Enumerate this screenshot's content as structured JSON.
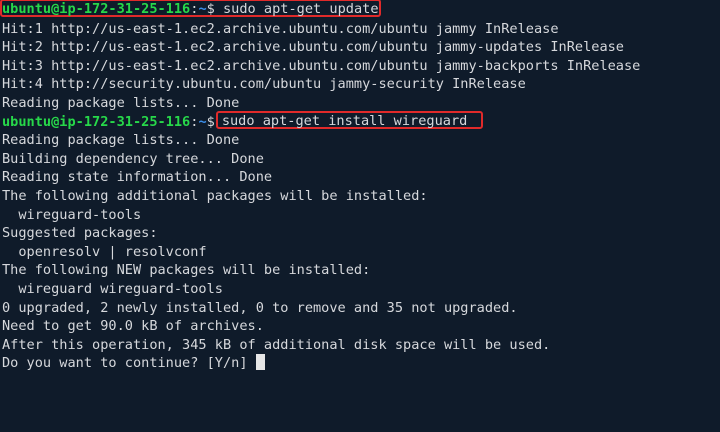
{
  "prompt": {
    "user_host": "ubuntu@ip-172-31-25-116",
    "separator": ":",
    "path": "~",
    "symbol": "$"
  },
  "commands": {
    "update": "sudo apt-get update",
    "install": "sudo apt-get install wireguard"
  },
  "update_output": [
    "Hit:1 http://us-east-1.ec2.archive.ubuntu.com/ubuntu jammy InRelease",
    "Hit:2 http://us-east-1.ec2.archive.ubuntu.com/ubuntu jammy-updates InRelease",
    "Hit:3 http://us-east-1.ec2.archive.ubuntu.com/ubuntu jammy-backports InRelease",
    "Hit:4 http://security.ubuntu.com/ubuntu jammy-security InRelease",
    "Reading package lists... Done"
  ],
  "install_output": [
    "Reading package lists... Done",
    "Building dependency tree... Done",
    "Reading state information... Done",
    "The following additional packages will be installed:",
    "  wireguard-tools",
    "Suggested packages:",
    "  openresolv | resolvconf",
    "The following NEW packages will be installed:",
    "  wireguard wireguard-tools",
    "0 upgraded, 2 newly installed, 0 to remove and 35 not upgraded.",
    "Need to get 90.0 kB of archives.",
    "After this operation, 345 kB of additional disk space will be used."
  ],
  "confirm_prompt": "Do you want to continue? [Y/n] ",
  "colors": {
    "background": "#0f1b2a",
    "prompt_user": "#27d84a",
    "prompt_path": "#3b8eea",
    "highlight_box": "#e02a2a",
    "text": "#d6d8dc"
  }
}
